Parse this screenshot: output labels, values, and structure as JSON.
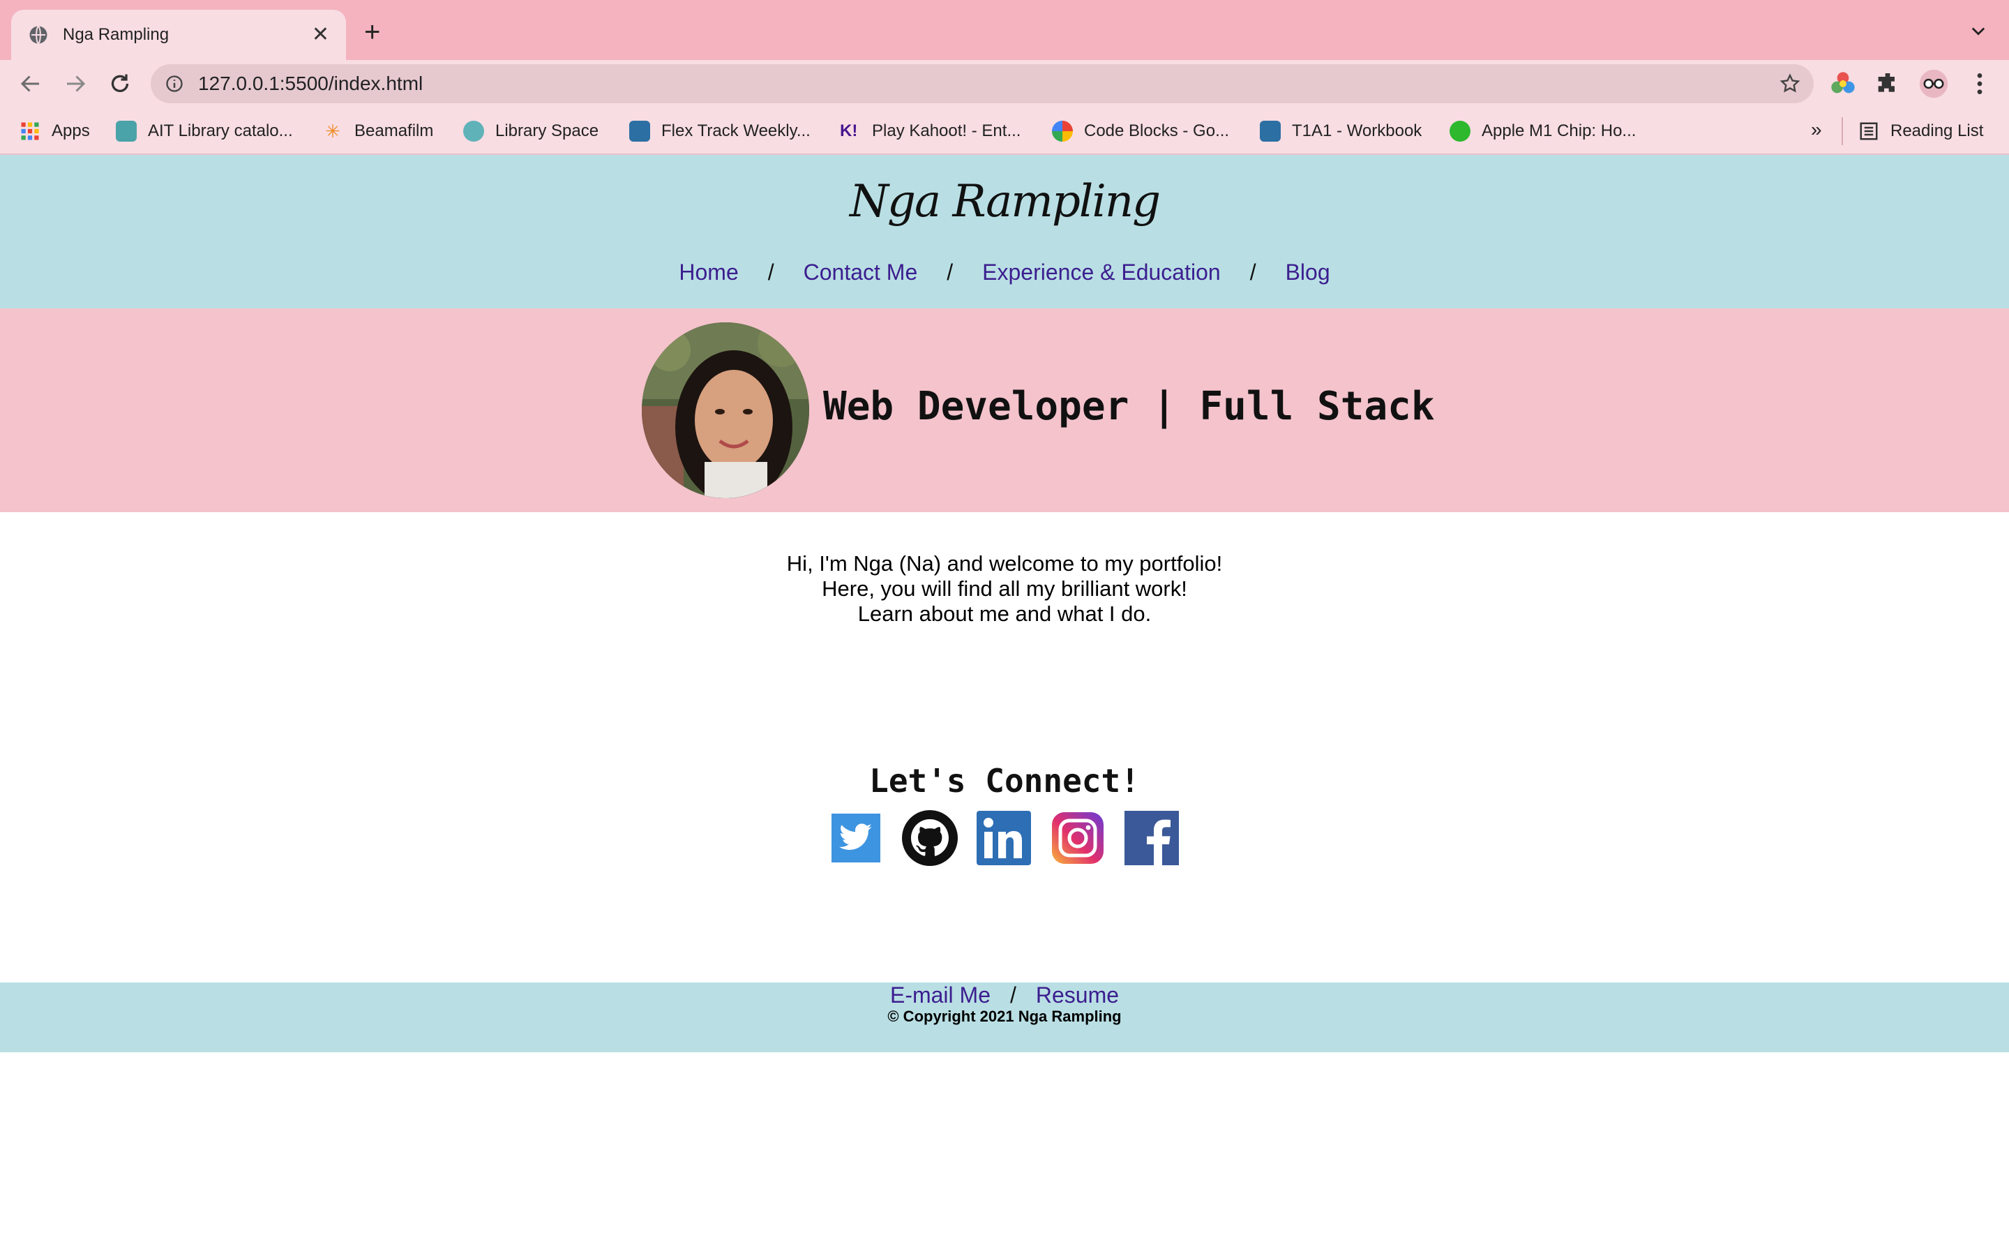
{
  "browser": {
    "tab_title": "Nga Rampling",
    "url": "127.0.0.1:5500/index.html",
    "bookmarks": [
      {
        "label": "Apps"
      },
      {
        "label": "AIT Library catalo..."
      },
      {
        "label": "Beamafilm"
      },
      {
        "label": "Library Space"
      },
      {
        "label": "Flex Track Weekly..."
      },
      {
        "label": "Play Kahoot! - Ent..."
      },
      {
        "label": "Code Blocks - Go..."
      },
      {
        "label": "T1A1 - Workbook"
      },
      {
        "label": "Apple M1 Chip: Ho..."
      }
    ],
    "more_label": "»",
    "reading_list": "Reading List"
  },
  "site": {
    "logo": "Nga Rampling",
    "nav": [
      "Home",
      "Contact Me",
      "Experience & Education",
      "Blog"
    ],
    "nav_separator": "/",
    "hero_title": "Web Developer | Full Stack",
    "intro": [
      "Hi, I'm Nga (Na) and welcome to my portfolio!",
      "Here, you will find all my brilliant work!",
      "Learn about me and what I do."
    ],
    "connect_title": "Let's Connect!",
    "social_icons": [
      "twitter-icon",
      "github-icon",
      "linkedin-icon",
      "instagram-icon",
      "facebook-icon"
    ],
    "footer": {
      "email_label": "E-mail Me",
      "separator": "/",
      "resume_label": "Resume",
      "copyright": "© Copyright 2021 Nga Rampling"
    }
  },
  "colors": {
    "tabbar": "#f4b3bf",
    "header_bg": "#b9dfe4",
    "hero_bg": "#f4c3cc",
    "link": "#3c1e8f"
  }
}
